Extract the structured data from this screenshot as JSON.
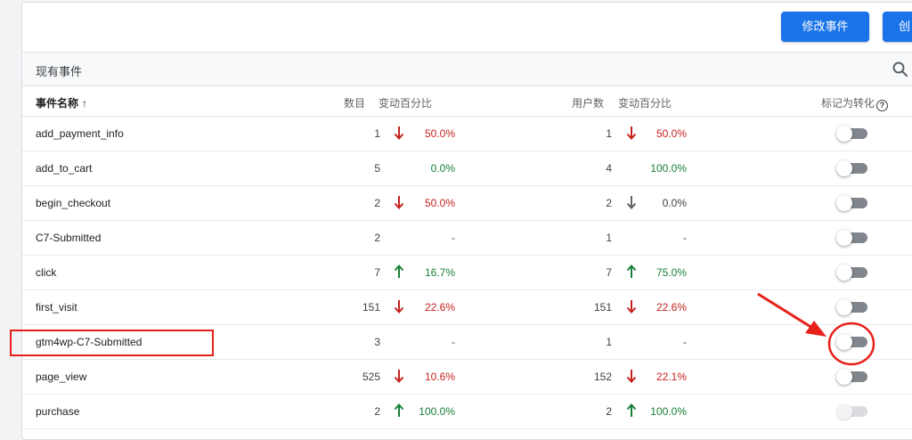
{
  "toolbar": {
    "edit_label": "修改事件",
    "create_label": "创"
  },
  "section": {
    "title": "现有事件"
  },
  "table": {
    "headers": {
      "name": "事件名称",
      "sort_arrow": "↑",
      "count": "数目",
      "count_change": "变动百分比",
      "users": "用户数",
      "users_change": "变动百分比",
      "conversion": "标记为转化",
      "help": "?"
    },
    "rows": [
      {
        "name": "add_payment_info",
        "count": "1",
        "count_dir": "down",
        "count_pct": "50.0%",
        "users": "1",
        "users_dir": "down",
        "users_pct": "50.0%",
        "conversion": false
      },
      {
        "name": "add_to_cart",
        "count": "5",
        "count_dir": "none",
        "count_pct": "0.0%",
        "users": "4",
        "users_dir": "none",
        "users_pct": "100.0%",
        "conversion": false
      },
      {
        "name": "begin_checkout",
        "count": "2",
        "count_dir": "down",
        "count_pct": "50.0%",
        "users": "2",
        "users_dir": "down-neutral",
        "users_pct": "0.0%",
        "conversion": false
      },
      {
        "name": "C7-Submitted",
        "count": "2",
        "count_dir": "none",
        "count_pct": "-",
        "users": "1",
        "users_dir": "none",
        "users_pct": "-",
        "conversion": false
      },
      {
        "name": "click",
        "count": "7",
        "count_dir": "up",
        "count_pct": "16.7%",
        "users": "7",
        "users_dir": "up",
        "users_pct": "75.0%",
        "conversion": false
      },
      {
        "name": "first_visit",
        "count": "151",
        "count_dir": "down",
        "count_pct": "22.6%",
        "users": "151",
        "users_dir": "down",
        "users_pct": "22.6%",
        "conversion": false
      },
      {
        "name": "gtm4wp-C7-Submitted",
        "count": "3",
        "count_dir": "none",
        "count_pct": "-",
        "users": "1",
        "users_dir": "none",
        "users_pct": "-",
        "conversion": false
      },
      {
        "name": "page_view",
        "count": "525",
        "count_dir": "down",
        "count_pct": "10.6%",
        "users": "152",
        "users_dir": "down",
        "users_pct": "22.1%",
        "conversion": false
      },
      {
        "name": "purchase",
        "count": "2",
        "count_dir": "up",
        "count_pct": "100.0%",
        "users": "2",
        "users_dir": "up",
        "users_pct": "100.0%",
        "conversion": true,
        "conversion_disabled": true
      }
    ]
  },
  "colors": {
    "accent": "#1a73e8",
    "negative": "#c5221f",
    "positive": "#188038",
    "annotation": "#e8201a"
  },
  "icons": {
    "search": "search-icon",
    "sort": "arrow-up-icon",
    "help": "help-circle-icon",
    "down": "arrow-down-icon",
    "up": "arrow-up-icon"
  }
}
